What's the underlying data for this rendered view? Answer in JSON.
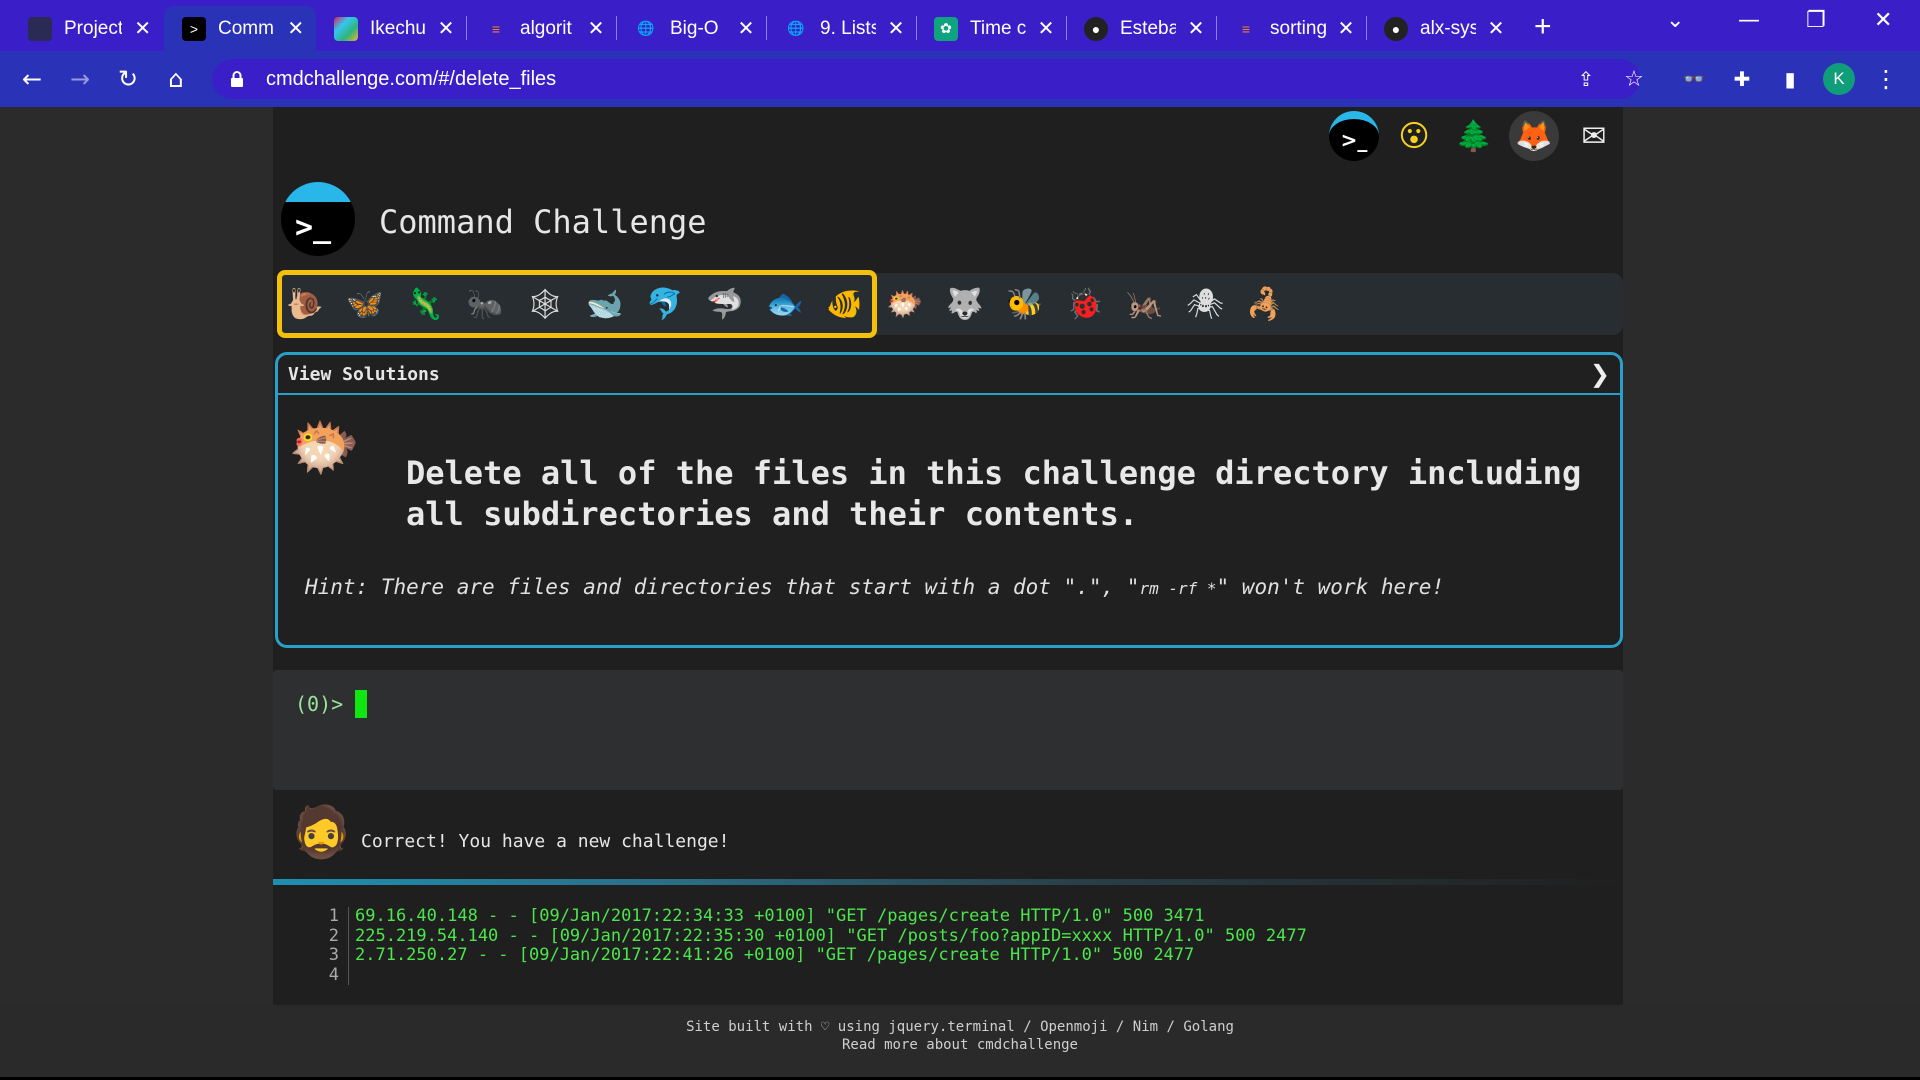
{
  "browser": {
    "tabs": [
      {
        "title": "Project"
      },
      {
        "title": "Comm"
      },
      {
        "title": "Ikechu"
      },
      {
        "title": "algorit"
      },
      {
        "title": "Big-O"
      },
      {
        "title": "9. Lists"
      },
      {
        "title": "Time c"
      },
      {
        "title": "Esteba"
      },
      {
        "title": "sorting"
      },
      {
        "title": "alx-sys"
      }
    ],
    "new_tab": "+",
    "url": "cmdchallenge.com/#/delete_files",
    "profile_initial": "K"
  },
  "site": {
    "title": "Command Challenge",
    "logo_prompt": ">_",
    "top_icons": [
      "terminal-icon",
      "face-icon",
      "tree-icon",
      "gitlab-icon",
      "mail-icon"
    ]
  },
  "levels": {
    "icons": [
      "snail",
      "butterfly",
      "lizard",
      "ant",
      "spider-web",
      "whale",
      "dolphin",
      "shark",
      "fish",
      "tropical-fish",
      "blowfish",
      "wolf",
      "bee",
      "ladybug",
      "cricket",
      "spider",
      "scorpion"
    ],
    "highlighted_count": 10
  },
  "challenge": {
    "view_solutions": "View Solutions",
    "chevron": "❯",
    "task": "Delete all of the files in this challenge directory including all subdirectories and their contents.",
    "hint_prefix": "Hint: There are files and directories that start with a dot \".\", \"",
    "hint_code": "rm -rf *",
    "hint_suffix": "\" won't work here!"
  },
  "terminal": {
    "prompt": "(0)>"
  },
  "feedback": {
    "message": "Correct! You have a new challenge!"
  },
  "log": {
    "lines": [
      {
        "n": "1",
        "text": "69.16.40.148 - - [09/Jan/2017:22:34:33 +0100] \"GET /pages/create HTTP/1.0\" 500 3471"
      },
      {
        "n": "2",
        "text": "225.219.54.140 - - [09/Jan/2017:22:35:30 +0100] \"GET /posts/foo?appID=xxxx HTTP/1.0\" 500 2477"
      },
      {
        "n": "3",
        "text": "2.71.250.27 - - [09/Jan/2017:22:41:26 +0100] \"GET /pages/create HTTP/1.0\" 500 2477"
      },
      {
        "n": "4",
        "text": ""
      }
    ]
  },
  "footer": {
    "line1": "Site built with ♡ using jquery.terminal / Openmoji / Nim / Golang",
    "line2": "Read more about cmdchallenge"
  }
}
